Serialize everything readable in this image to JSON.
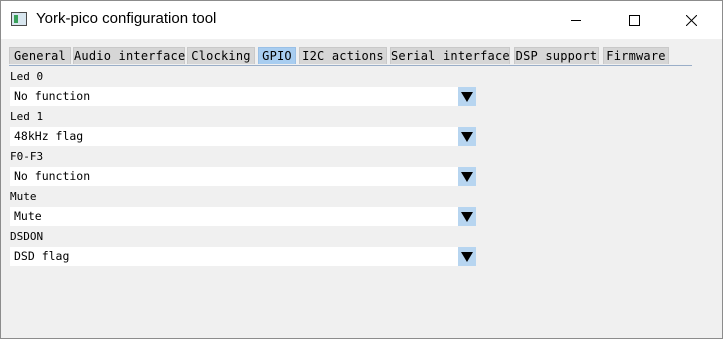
{
  "window": {
    "title": "York-pico configuration tool",
    "controls": [
      "minimize-icon",
      "maximize-icon",
      "close-icon"
    ]
  },
  "tabs": [
    {
      "label": "General",
      "active": false
    },
    {
      "label": "Audio interface",
      "active": false
    },
    {
      "label": "Clocking",
      "active": false
    },
    {
      "label": "GPIO",
      "active": true
    },
    {
      "label": "I2C actions",
      "active": false
    },
    {
      "label": "Serial interface",
      "active": false
    },
    {
      "label": "DSP support",
      "active": false
    },
    {
      "label": "Firmware",
      "active": false
    }
  ],
  "gpio": {
    "fields": [
      {
        "label": "Led 0",
        "value": "No function"
      },
      {
        "label": "Led 1",
        "value": "48kHz flag"
      },
      {
        "label": "F0-F3",
        "value": "No function"
      },
      {
        "label": "Mute",
        "value": "Mute"
      },
      {
        "label": "DSDON",
        "value": "DSD flag"
      }
    ],
    "dropdown_icon": "triangle-down-icon"
  },
  "colors": {
    "active_tab": "#a8cdf0",
    "dropdown_button": "#b7d5f0",
    "background": "#f0f0f0"
  }
}
